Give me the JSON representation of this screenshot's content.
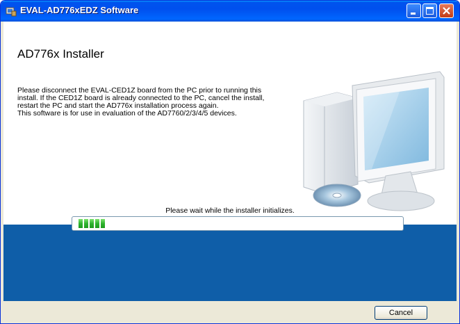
{
  "window": {
    "title": "EVAL-AD776xEDZ Software",
    "colors": {
      "titlebar": "#0053ee",
      "band": "#0f5ea8",
      "progress_fill": "#2fb32f"
    }
  },
  "main": {
    "heading": "AD776x Installer",
    "message_lines": [
      "Please disconnect the EVAL-CED1Z board from the PC prior to running this",
      "install. If the CED1Z board is already connected to the PC, cancel the install,",
      "restart the PC and start the AD776x installation process again.",
      "This software is for use in evaluation of the AD7760/2/3/4/5 devices."
    ],
    "status_text": "Please wait while the installer initializes.",
    "progress_fraction": 0.08
  },
  "footer": {
    "cancel_label": "Cancel"
  },
  "icons": {
    "window": "installer-icon",
    "minimize": "minimize-icon",
    "maximize": "maximize-icon",
    "close": "close-icon",
    "illustration": "computer-illustration"
  }
}
